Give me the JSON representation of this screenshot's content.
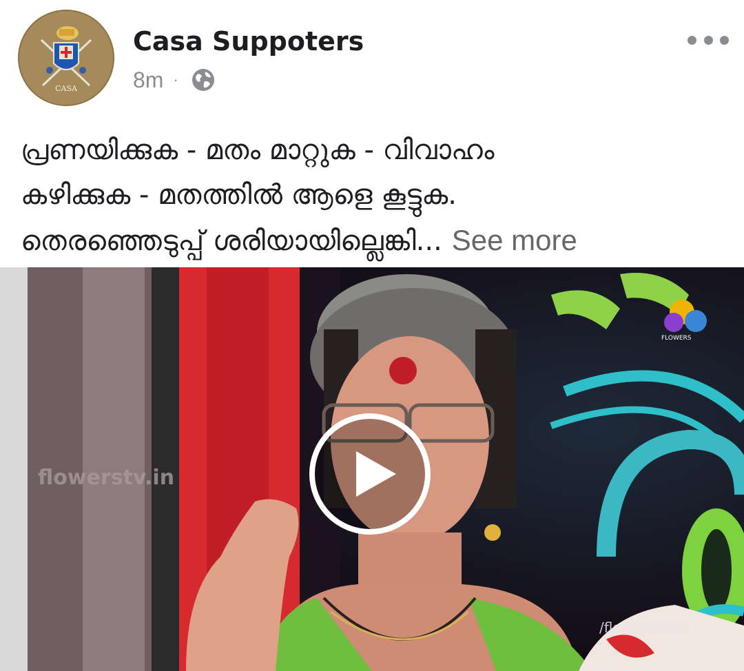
{
  "post": {
    "author": "Casa Suppoters",
    "time": "8m",
    "separator": "·",
    "privacy_icon": "globe-icon",
    "menu_icon": "more-options-icon",
    "avatar_label": "CASA",
    "text_lines": [
      "പ്രണയിക്കുക - മതം മാറ്റുക - വിവാഹം",
      "കഴിക്കുക - മതത്തിൽ ആളെ കൂട്ടുക.",
      "തെരഞ്ഞെടുപ്പ് ശരിയായില്ലെങ്കി..."
    ],
    "see_more": "See more"
  },
  "video": {
    "watermark_left": "flowerstv.in",
    "watermark_right": "/flowersonair",
    "channel_logo_text": "FLOWERS",
    "play_icon": "play-icon"
  },
  "colors": {
    "text": "#1c1e21",
    "secondary": "#65676b",
    "meta": "#8a8d91",
    "avatar_bg": "#a58a5c"
  }
}
